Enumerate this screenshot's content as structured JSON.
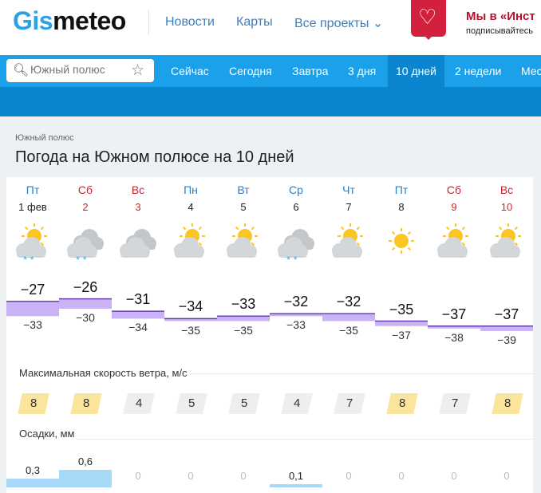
{
  "header": {
    "logo_a": "Gis",
    "logo_b": "meteo",
    "nav": [
      "Новости",
      "Карты",
      "Все проекты ⌄"
    ],
    "promo_title": "Мы в «Инст",
    "promo_sub": "подписывайтесь"
  },
  "search": {
    "value": "",
    "placeholder": "Южный полюс"
  },
  "tabs": [
    "Сейчас",
    "Сегодня",
    "Завтра",
    "3 дня",
    "10 дней",
    "2 недели",
    "Мес"
  ],
  "active_tab": "10 дней",
  "breadcrumb": "Южный полюс",
  "title": "Погода на Южном полюсе на 10 дней",
  "colors": {
    "accent": "#1ba0ea",
    "accent_dark": "#0c85d0",
    "weekend": "#c8262e",
    "weekday": "#2b7cc4",
    "temp_band": "#c9b3f5",
    "wind_high": "#fbe59c"
  },
  "days": [
    {
      "name": "Пт",
      "date": "1 фев",
      "weekend": false,
      "icon": "sun-cloud",
      "snow": true,
      "max": "−27",
      "min": "−33",
      "tmax": -27,
      "tmin": -33,
      "wind": "8",
      "wind_high": true,
      "precip": "0,3",
      "p": 0.3
    },
    {
      "name": "Сб",
      "date": "2",
      "weekend": true,
      "icon": "cloud",
      "snow": true,
      "max": "−26",
      "min": "−30",
      "tmax": -26,
      "tmin": -30,
      "wind": "8",
      "wind_high": true,
      "precip": "0,6",
      "p": 0.6
    },
    {
      "name": "Вс",
      "date": "3",
      "weekend": true,
      "icon": "cloud",
      "snow": false,
      "max": "−31",
      "min": "−34",
      "tmax": -31,
      "tmin": -34,
      "wind": "4",
      "wind_high": false,
      "precip": "0",
      "p": 0
    },
    {
      "name": "Пн",
      "date": "4",
      "weekend": false,
      "icon": "sun-cloud",
      "snow": false,
      "max": "−34",
      "min": "−35",
      "tmax": -34,
      "tmin": -35,
      "wind": "5",
      "wind_high": false,
      "precip": "0",
      "p": 0
    },
    {
      "name": "Вт",
      "date": "5",
      "weekend": false,
      "icon": "sun-cloud",
      "snow": false,
      "max": "−33",
      "min": "−35",
      "tmax": -33,
      "tmin": -35,
      "wind": "5",
      "wind_high": false,
      "precip": "0",
      "p": 0
    },
    {
      "name": "Ср",
      "date": "6",
      "weekend": false,
      "icon": "cloud",
      "snow": true,
      "max": "−32",
      "min": "−33",
      "tmax": -32,
      "tmin": -33,
      "wind": "4",
      "wind_high": false,
      "precip": "0,1",
      "p": 0.1
    },
    {
      "name": "Чт",
      "date": "7",
      "weekend": false,
      "icon": "sun-cloud",
      "snow": false,
      "max": "−32",
      "min": "−35",
      "tmax": -32,
      "tmin": -35,
      "wind": "7",
      "wind_high": false,
      "precip": "0",
      "p": 0
    },
    {
      "name": "Пт",
      "date": "8",
      "weekend": false,
      "icon": "sun",
      "snow": false,
      "max": "−35",
      "min": "−37",
      "tmax": -35,
      "tmin": -37,
      "wind": "8",
      "wind_high": true,
      "precip": "0",
      "p": 0
    },
    {
      "name": "Сб",
      "date": "9",
      "weekend": true,
      "icon": "sun-cloud",
      "snow": false,
      "max": "−37",
      "min": "−38",
      "tmax": -37,
      "tmin": -38,
      "wind": "7",
      "wind_high": false,
      "precip": "0",
      "p": 0
    },
    {
      "name": "Вс",
      "date": "10",
      "weekend": true,
      "icon": "sun-cloud",
      "snow": false,
      "max": "−37",
      "min": "−39",
      "tmax": -37,
      "tmin": -39,
      "wind": "8",
      "wind_high": true,
      "precip": "0",
      "p": 0
    }
  ],
  "wind_label": "Максимальная скорость ветра, м/с",
  "precip_label": "Осадки, мм"
}
